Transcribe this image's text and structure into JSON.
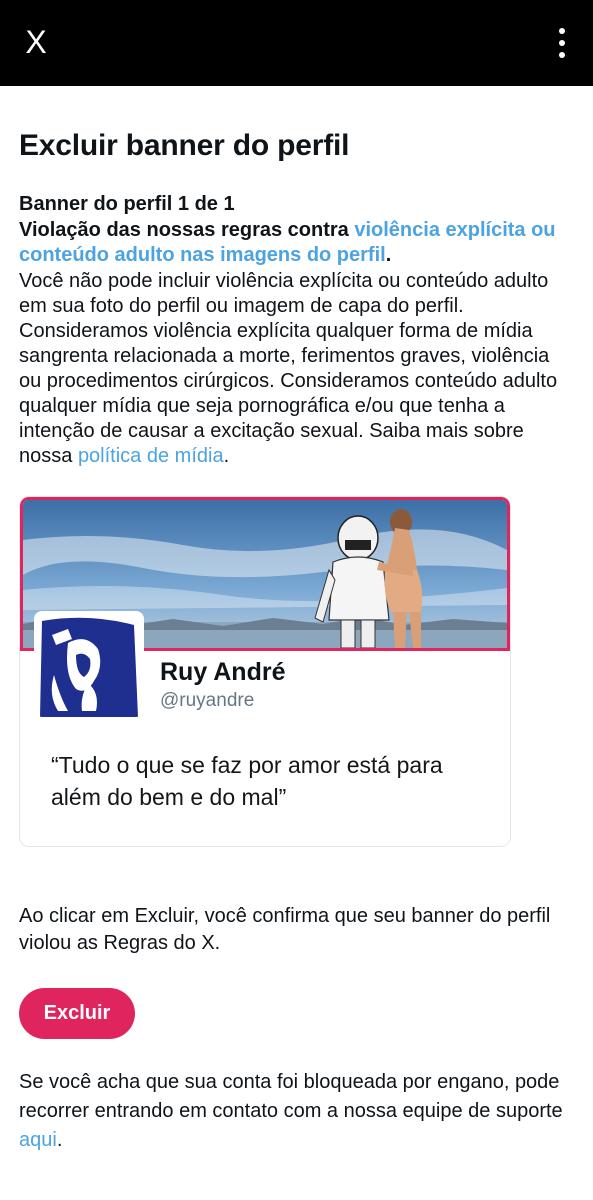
{
  "topbar": {
    "close_label": "X",
    "close_icon": "close-icon",
    "more_icon": "more-vertical-icon"
  },
  "page": {
    "title": "Excluir banner do perfil",
    "counter": "Banner do perfil 1 de 1",
    "violation_prefix": "Violação das nossas regras contra ",
    "violation_link": "violência explícita ou conteúdo adulto nas imagens do perfil",
    "violation_suffix": ".",
    "body_text": "Você não pode incluir violência explícita ou conteúdo adulto em sua foto do perfil ou imagem de capa do perfil. Consideramos violência explícita qualquer forma de mídia sangrenta relacionada a morte, ferimentos graves, violência ou procedimentos cirúrgicos. Consideramos conteúdo adulto qualquer mídia que seja pornográfica e/ou que tenha a intenção de causar a excitação sexual. Saiba mais sobre nossa ",
    "media_policy_link": "política de mídia",
    "body_suffix": "."
  },
  "profile_card": {
    "name": "Ruy André",
    "handle": "@ruyandre",
    "bio": "“Tudo o que se faz por amor está para além do bem e do mal”"
  },
  "confirm_text": "Ao clicar em Excluir, você confirma que seu banner do perfil violou as Regras do X.",
  "delete_button": "Excluir",
  "appeal": {
    "text": "Se você acha que sua conta foi bloqueada por engano, pode recorrer entrando em contato com a nossa equipe de suporte ",
    "link": "aqui",
    "suffix": "."
  },
  "colors": {
    "accent_link": "#4ba3e3",
    "danger": "#e0245e",
    "topbar": "#000000"
  }
}
